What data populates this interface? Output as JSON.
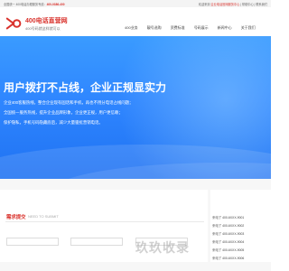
{
  "topbar": {
    "left_text": "全国统一 400电话办理服务专线：",
    "phone": "400-0386-400",
    "right_text_1": "欢迎来到",
    "right_link": "企业电话官网服务中心",
    "right_text_2": "| 帮助中心 | 联系我们"
  },
  "header": {
    "logo_sub": "400PHONE.COM",
    "brand": "400电话直营网",
    "slogan": "400号码就这样就可以",
    "nav": [
      {
        "label": "400业务"
      },
      {
        "label": "靓号选购"
      },
      {
        "label": "资费标准"
      },
      {
        "label": "号码展示"
      },
      {
        "label": "新闻中心"
      },
      {
        "label": "关于我们"
      }
    ]
  },
  "banner": {
    "headline": "用户拨打不占线，企业正规显实力",
    "lines": [
      "企业400客服热线，整合企业现有固话和手机，再也不用分电话占线问题；",
      "全国统一服务热线，提升企业品牌形象，企业更正规，用户更信赖；",
      "保护隐私，手机号码隐藏底后，减少大量骚扰营销电话。"
    ]
  },
  "form": {
    "title": "需求提交",
    "title_en": "NEED TO SUBMIT",
    "fields": [
      {
        "label": "姓名"
      },
      {
        "label": "公司名称"
      },
      {
        "label": "手机号码"
      }
    ]
  },
  "phones": [
    {
      "prefix": "来电了",
      "number": "400-6XXX-9001"
    },
    {
      "prefix": "来电了",
      "number": "400-6XXX-9002"
    },
    {
      "prefix": "来电了",
      "number": "400-6XXX-9003"
    },
    {
      "prefix": "来电了",
      "number": "400-6XXX-9004"
    },
    {
      "prefix": "来电了",
      "number": "400-6XXX-9005"
    },
    {
      "prefix": "来电了",
      "number": "400-6XXX-9006"
    }
  ],
  "watermark": "玖玖收录",
  "colors": {
    "brand_red": "#d9322c",
    "banner_blue": "#2f86ff"
  }
}
